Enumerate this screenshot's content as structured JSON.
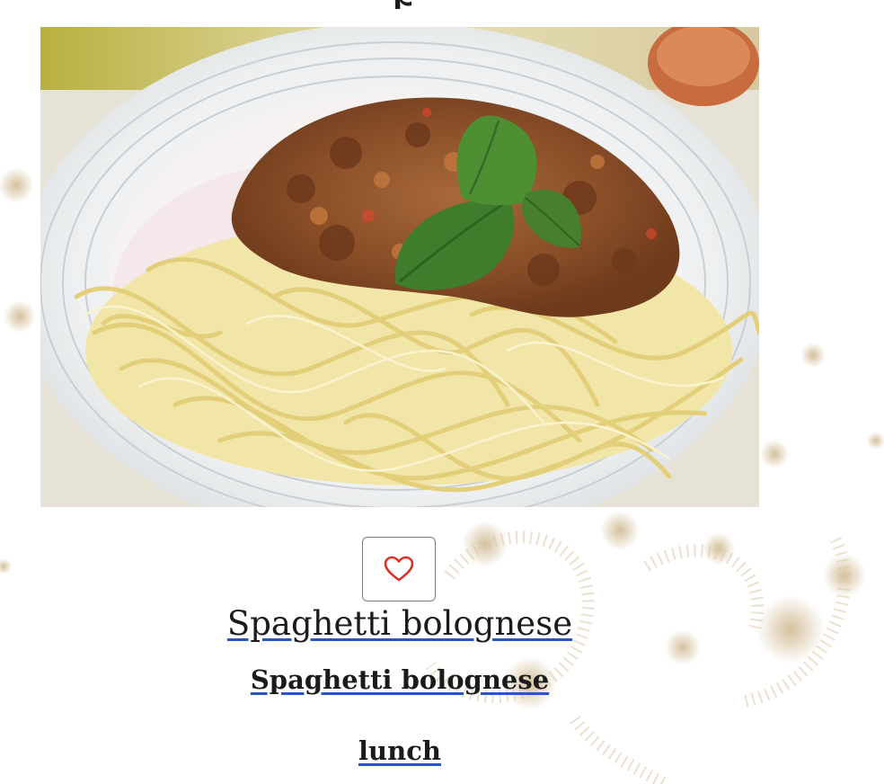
{
  "page": {
    "heading_fragment": "p"
  },
  "recipe": {
    "image_alt": "Spaghetti bolognese",
    "favorite_icon": "heart-icon",
    "title": "Spaghetti bolognese",
    "subtitle": "Spaghetti bolognese",
    "category": "lunch"
  },
  "colors": {
    "heart": "#d9342b",
    "link_underline": "#2a55c8",
    "text": "#1b1b1b"
  }
}
